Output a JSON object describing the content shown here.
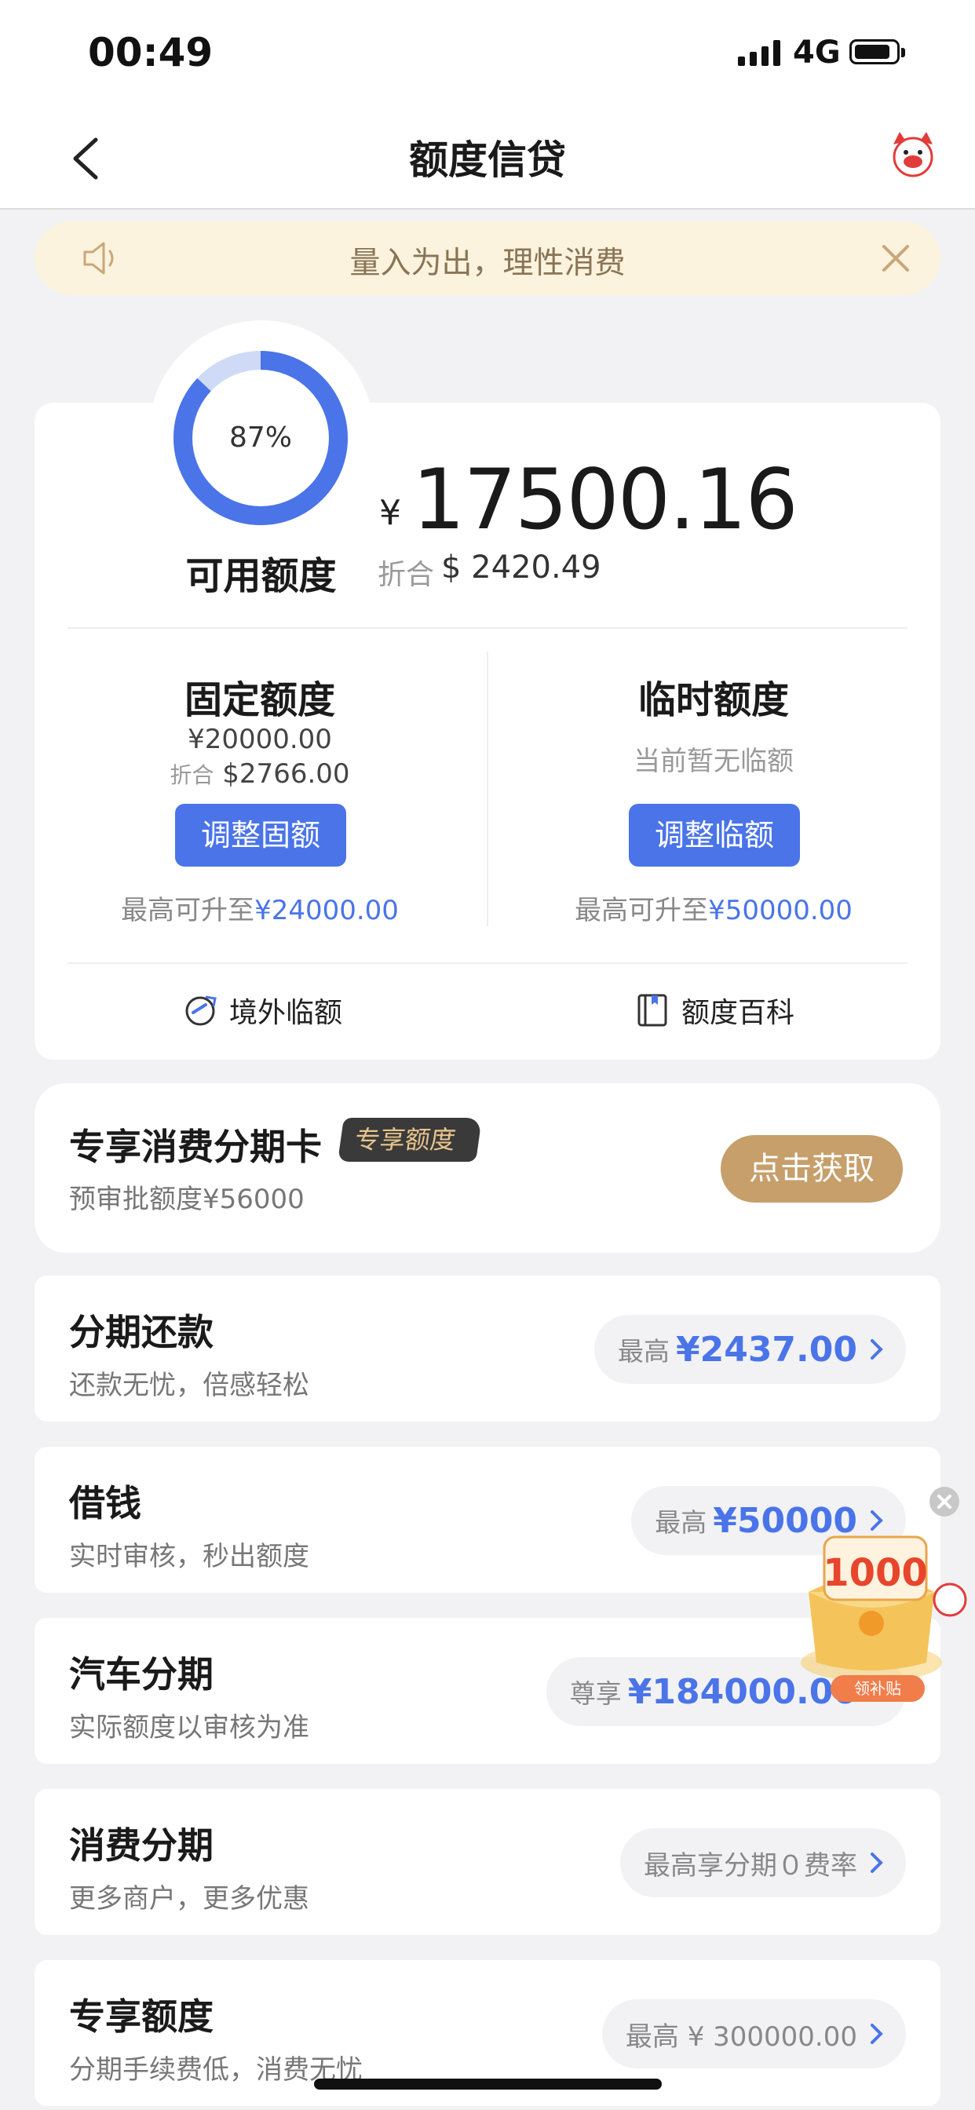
{
  "status_bar": {
    "time": "00:49",
    "network": "4G"
  },
  "nav": {
    "title": "额度信贷"
  },
  "notice": {
    "text": "量入为出，理性消费"
  },
  "credit": {
    "usage_percent": 87,
    "usage_label": "87%",
    "available_label": "可用额度",
    "currency_symbol": "¥",
    "available_amount": "17500.16",
    "fold_label": "折合",
    "fold_value": "$ 2420.49",
    "fixed": {
      "title": "固定额度",
      "amount": "¥20000.00",
      "fold_label": "折合",
      "fold_value": "$2766.00",
      "button": "调整固额",
      "max_prefix": "最高可升至",
      "max_value": "¥24000.00"
    },
    "temp": {
      "title": "临时额度",
      "note": "当前暂无临额",
      "button": "调整临额",
      "max_prefix": "最高可升至",
      "max_value": "¥50000.00"
    },
    "links": [
      {
        "label": "境外临额",
        "icon": "overseas-quota-icon"
      },
      {
        "label": "额度百科",
        "icon": "book-icon"
      }
    ]
  },
  "promo": {
    "title": "专享消费分期卡",
    "badge": "专享额度",
    "subtitle": "预审批额度¥56000",
    "button": "点击获取"
  },
  "services": [
    {
      "title": "分期还款",
      "subtitle": "还款无忧，倍感轻松",
      "prefix": "最高",
      "amount": "¥2437.00"
    },
    {
      "title": "借钱",
      "subtitle": "实时审核，秒出额度",
      "prefix": "最高",
      "amount": "¥50000"
    },
    {
      "title": "汽车分期",
      "subtitle": "实际额度以审核为准",
      "prefix": "尊享",
      "amount": "¥184000.00"
    },
    {
      "title": "消费分期",
      "subtitle": "更多商户，更多优惠",
      "text": "最高享分期０费率"
    },
    {
      "title": "专享额度",
      "subtitle": "分期手续费低，消费无忧",
      "text": "最高 ¥ 300000.00"
    }
  ],
  "floating_ad": {
    "amount": "1000",
    "label": "领补贴"
  },
  "colors": {
    "accent": "#4a74e8",
    "gold": "#c69f6b",
    "notice_bg": "#fbf3dd"
  }
}
